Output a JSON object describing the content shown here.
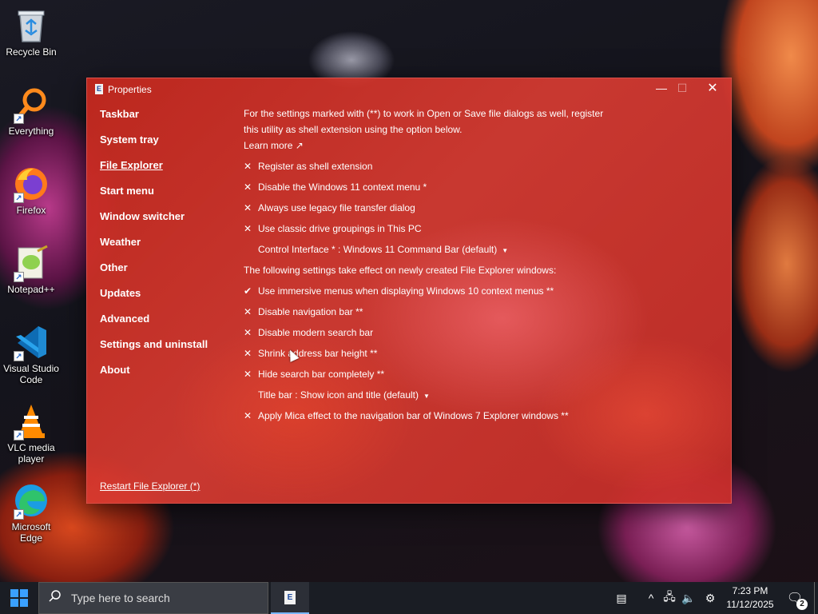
{
  "desktop": {
    "icons": [
      {
        "label": "Recycle Bin"
      },
      {
        "label": "Everything"
      },
      {
        "label": "Firefox"
      },
      {
        "label": "Notepad++"
      },
      {
        "label": "Visual Studio Code"
      },
      {
        "label": "VLC media player"
      },
      {
        "label": "Microsoft Edge"
      }
    ]
  },
  "window": {
    "title": "Properties",
    "app_icon_glyph": "E",
    "controls": {
      "minimize": "—",
      "maximize": "☐",
      "close": "✕"
    },
    "nav": [
      {
        "label": "Taskbar",
        "active": false
      },
      {
        "label": "System tray",
        "active": false
      },
      {
        "label": "File Explorer",
        "active": true
      },
      {
        "label": "Start menu",
        "active": false
      },
      {
        "label": "Window switcher",
        "active": false
      },
      {
        "label": "Weather",
        "active": false
      },
      {
        "label": "Other",
        "active": false
      },
      {
        "label": "Updates",
        "active": false
      },
      {
        "label": "Advanced",
        "active": false
      },
      {
        "label": "Settings and uninstall",
        "active": false
      },
      {
        "label": "About",
        "active": false
      }
    ],
    "restart_link": "Restart File Explorer (*)",
    "content": {
      "intro": "For the settings marked with (**) to work in Open or Save file dialogs as well, register this utility as shell extension using the option below.",
      "learn_more": "Learn more ↗",
      "options": [
        {
          "mark": "✕",
          "label": "Register as shell extension"
        },
        {
          "mark": "✕",
          "label": "Disable the Windows 11 context menu *"
        },
        {
          "mark": "✕",
          "label": "Always use legacy file transfer dialog"
        },
        {
          "mark": "✕",
          "label": "Use classic drive groupings in This PC"
        },
        {
          "mark": "",
          "label": "Control Interface * : Windows 11 Command Bar (default)",
          "dropdown": true
        },
        {
          "mark": "",
          "label": "The following settings take effect on newly created File Explorer windows:",
          "note": true
        },
        {
          "mark": "✔",
          "label": "Use immersive menus when displaying Windows 10 context menus **"
        },
        {
          "mark": "✕",
          "label": "Disable navigation bar **"
        },
        {
          "mark": "✕",
          "label": "Disable modern search bar"
        },
        {
          "mark": "✕",
          "label": "Shrink address bar height **"
        },
        {
          "mark": "✕",
          "label": "Hide search bar completely **"
        },
        {
          "mark": "",
          "label": "Title bar : Show icon and title (default)",
          "dropdown": true
        },
        {
          "mark": "✕",
          "label": "Apply Mica effect to the navigation bar of Windows 7 Explorer windows **"
        }
      ],
      "dropdown_caret": "▼"
    }
  },
  "taskbar": {
    "search_placeholder": "Type here to search",
    "running_app_glyph": "E",
    "tray": {
      "news": "▤",
      "chevron": "^",
      "network": "🖧",
      "volume": "🔈",
      "settings": "⚙"
    },
    "time": "7:23 PM",
    "date": "11/12/2025",
    "notifications_count": "2",
    "notifications_glyph": "🗨"
  },
  "colors": {
    "window_tint": "#d23a30",
    "taskbar": "#1a1d24",
    "accent": "#3aa0ff"
  }
}
